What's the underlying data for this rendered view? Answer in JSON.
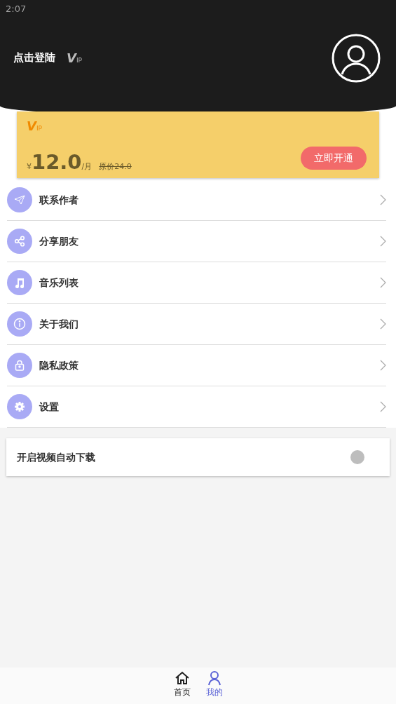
{
  "status_bar": {
    "time": "2:07"
  },
  "header": {
    "login_label": "点击登陆",
    "vip_mark": {
      "big": "V",
      "small": "IP"
    }
  },
  "vip_card": {
    "vip_mark": {
      "big": "V",
      "small": "IP"
    },
    "currency": "¥",
    "price": "12.0",
    "unit": "/月",
    "original_price": "原价24.0",
    "button": "立即开通"
  },
  "menu": [
    {
      "kind": "plane",
      "label": "联系作者"
    },
    {
      "kind": "share",
      "label": "分享朋友"
    },
    {
      "kind": "music",
      "label": "音乐列表"
    },
    {
      "kind": "info",
      "label": "关于我们"
    },
    {
      "kind": "lock",
      "label": "隐私政策"
    },
    {
      "kind": "gear",
      "label": "设置"
    }
  ],
  "auto_download": {
    "label": "开启视频自动下载",
    "on": false
  },
  "tab_bar": [
    {
      "kind": "home",
      "label": "首页",
      "selected": false
    },
    {
      "kind": "person",
      "label": "我的",
      "selected": true
    }
  ]
}
